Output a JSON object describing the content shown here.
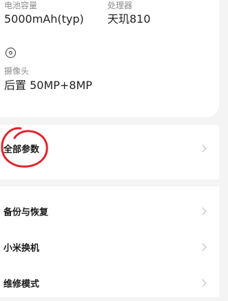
{
  "specs": {
    "battery": {
      "label": "电池容量",
      "value": "5000mAh(typ)"
    },
    "processor": {
      "label": "处理器",
      "value": "天玑810"
    },
    "camera": {
      "label": "摄像头",
      "value": "后置 50MP+8MP",
      "icon": "camera-icon"
    }
  },
  "menu": {
    "all_params": "全部参数",
    "items": [
      {
        "label": "备份与恢复"
      },
      {
        "label": "小米换机"
      },
      {
        "label": "维修模式"
      }
    ]
  },
  "colors": {
    "background": "#f4f4f5",
    "card": "#ffffff",
    "annotation": "#e0242a"
  }
}
